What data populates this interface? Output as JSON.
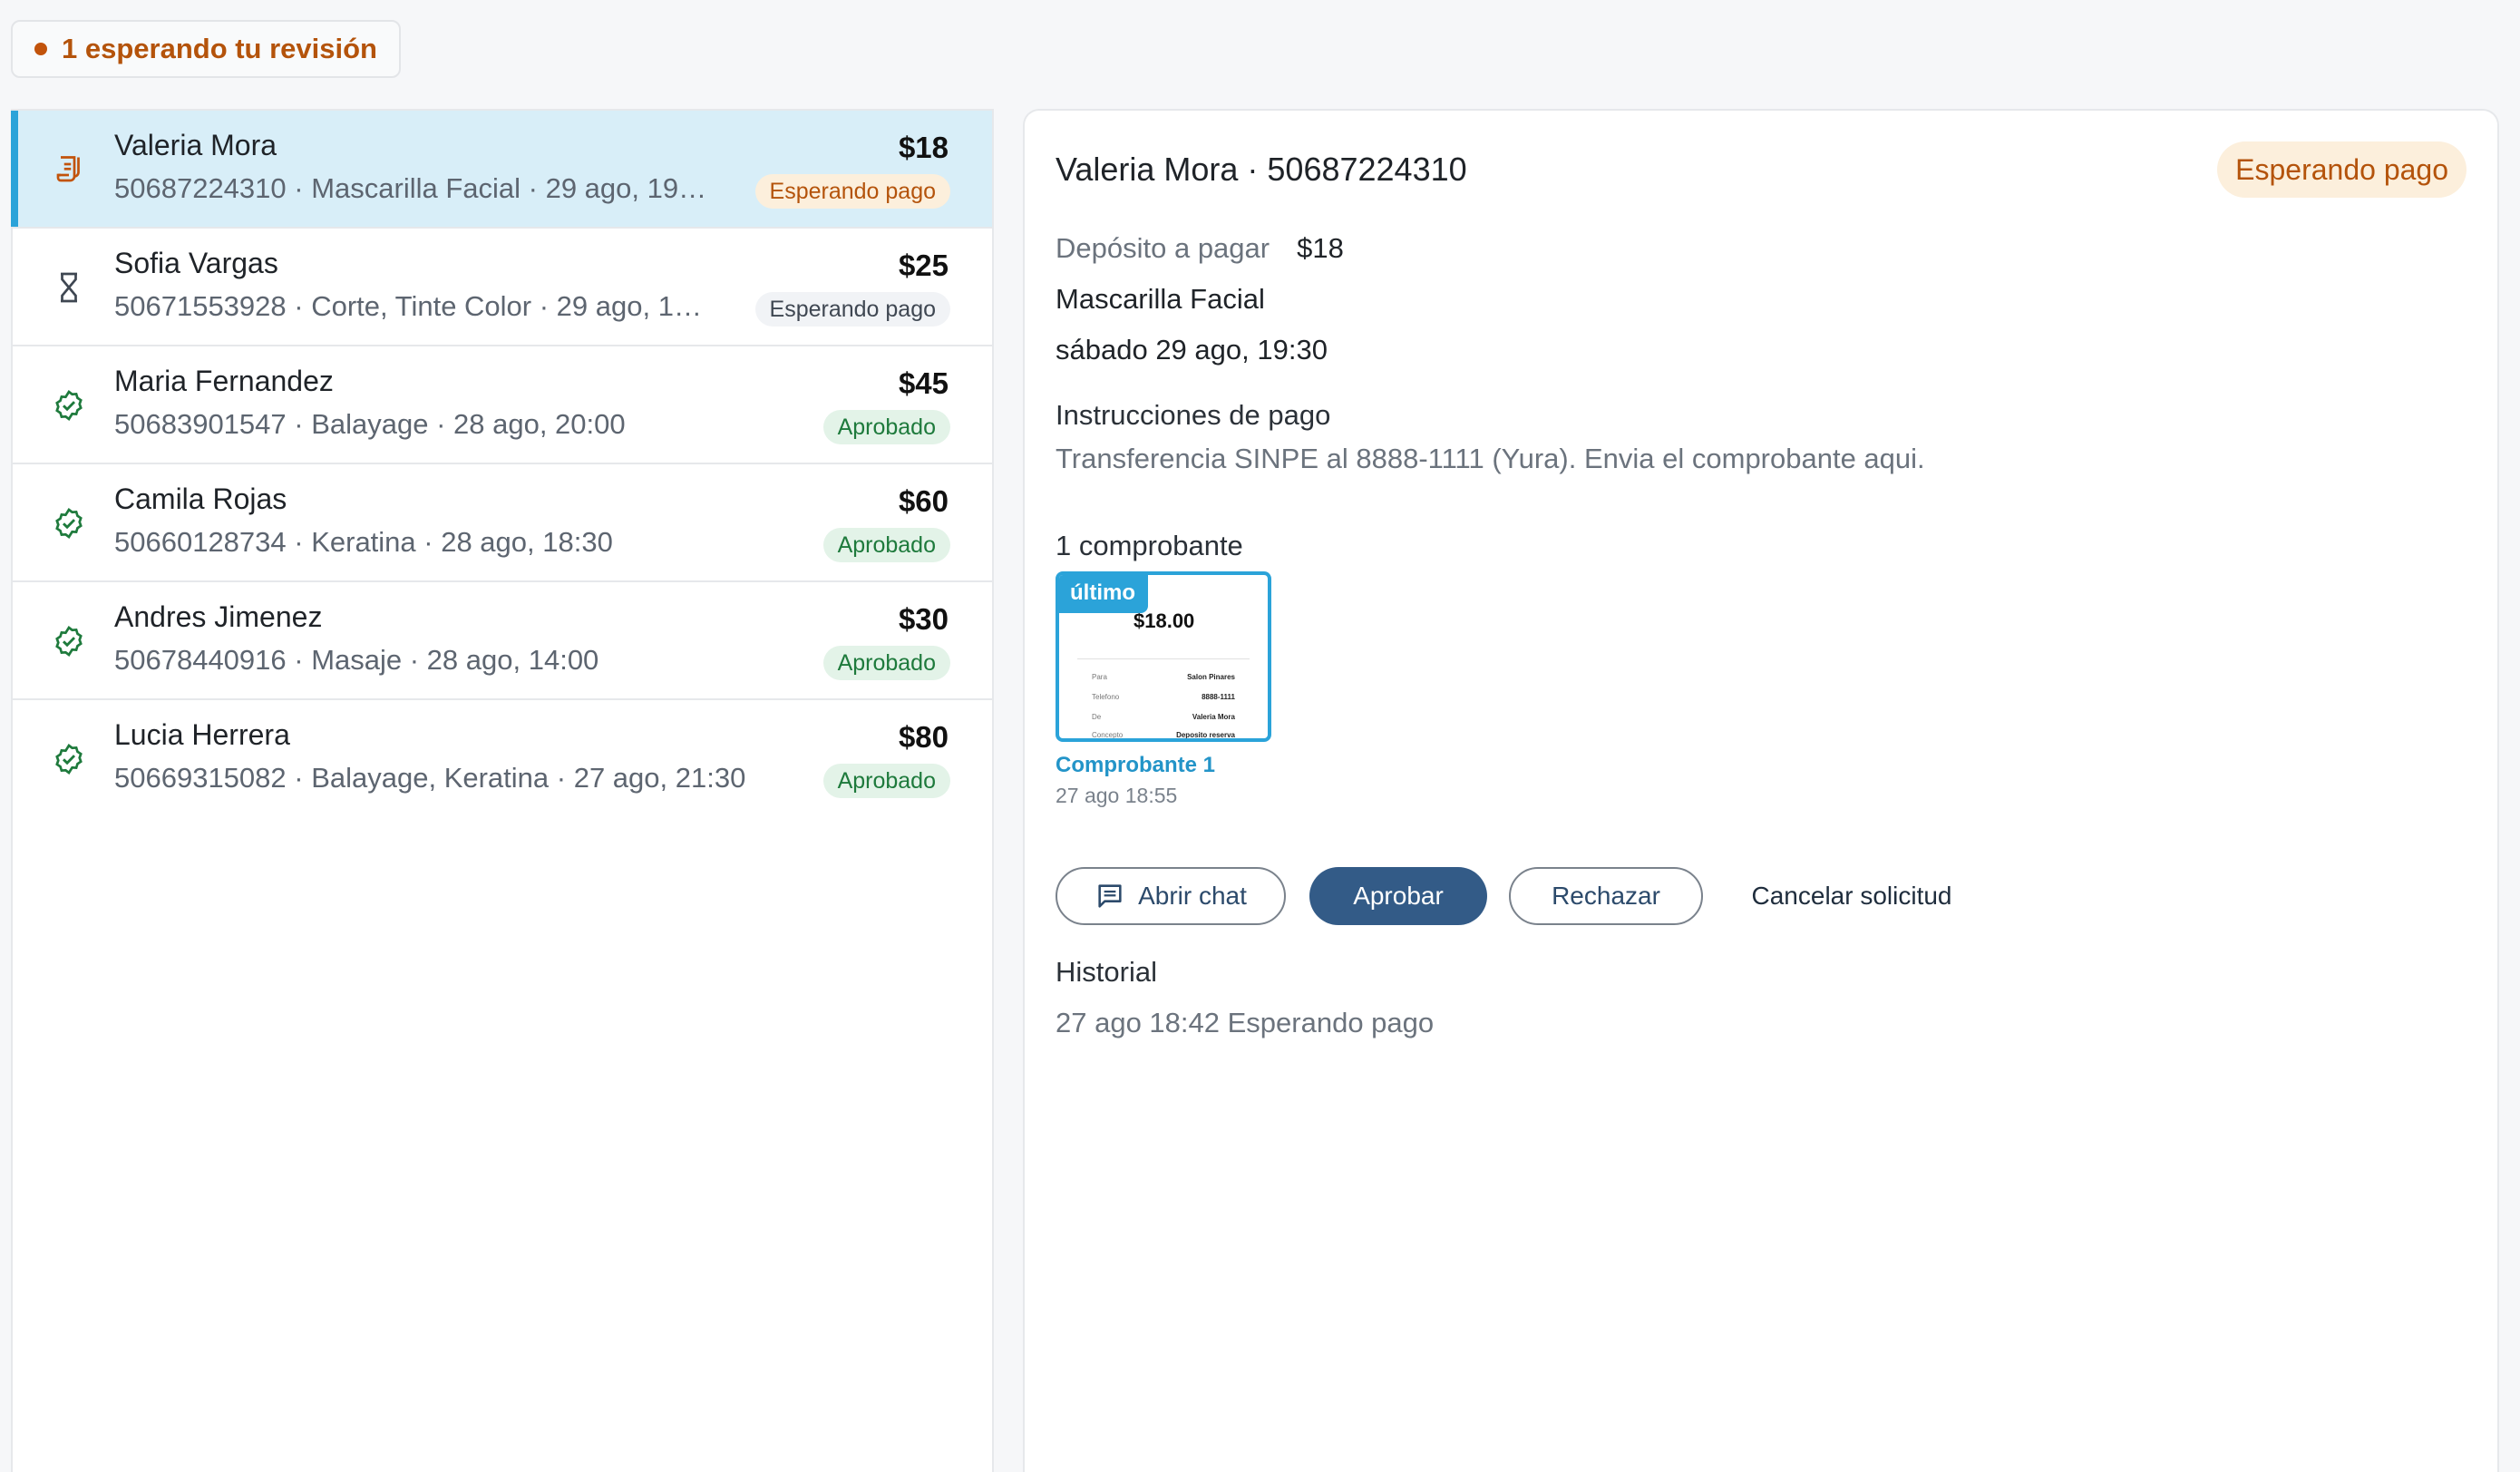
{
  "header": {
    "review_chip": "1 esperando tu revisión"
  },
  "requests": [
    {
      "name": "Valeria Mora",
      "meta": "50687224310 · Mascarilla Facial · 29 ago, 19…",
      "amount": "$18",
      "status": "Esperando pago",
      "icon": "receipt-icon"
    },
    {
      "name": "Sofia Vargas",
      "meta": "50671553928 · Corte, Tinte Color · 29 ago, 1…",
      "amount": "$25",
      "status": "Esperando pago",
      "icon": "hourglass-icon"
    },
    {
      "name": "Maria Fernandez",
      "meta": "50683901547 · Balayage · 28 ago, 20:00",
      "amount": "$45",
      "status": "Aprobado",
      "icon": "verified-icon"
    },
    {
      "name": "Camila Rojas",
      "meta": "50660128734 · Keratina · 28 ago, 18:30",
      "amount": "$60",
      "status": "Aprobado",
      "icon": "verified-icon"
    },
    {
      "name": "Andres Jimenez",
      "meta": "50678440916 · Masaje · 28 ago, 14:00",
      "amount": "$30",
      "status": "Aprobado",
      "icon": "verified-icon"
    },
    {
      "name": "Lucia Herrera",
      "meta": "50669315082 · Balayage, Keratina · 27 ago, 21:30",
      "amount": "$80",
      "status": "Aprobado",
      "icon": "verified-icon"
    }
  ],
  "detail": {
    "title": "Valeria Mora · 50687224310",
    "status": "Esperando pago",
    "deposit_label": "Depósito a pagar",
    "deposit_value": "$18",
    "service": "Mascarilla Facial",
    "datetime": "sábado 29 ago, 19:30",
    "instructions_title": "Instrucciones de pago",
    "instructions_text": "Transferencia SINPE al 8888-1111 (Yura). Envia el comprobante aqui.",
    "receipts_count": "1 comprobante",
    "receipt": {
      "badge": "último",
      "amount": "$18.00",
      "caption": "Comprobante 1",
      "date": "27 ago 18:55",
      "preview_rows": [
        {
          "label": "Para",
          "value": "Salon Pinares"
        },
        {
          "label": "Telefono",
          "value": "8888-1111"
        },
        {
          "label": "De",
          "value": "Valeria Mora"
        },
        {
          "label": "Concepto",
          "value": "Deposito reserva"
        }
      ]
    },
    "buttons": {
      "chat": "Abrir chat",
      "approve": "Aprobar",
      "reject": "Rechazar",
      "cancel": "Cancelar solicitud"
    },
    "history_title": "Historial",
    "history": [
      "27 ago 18:42 Esperando pago"
    ]
  },
  "colors": {
    "accent_blue": "#2ba3d9",
    "primary_button": "#335b87",
    "waiting": "#b4530b",
    "approved": "#1e7a3c"
  }
}
